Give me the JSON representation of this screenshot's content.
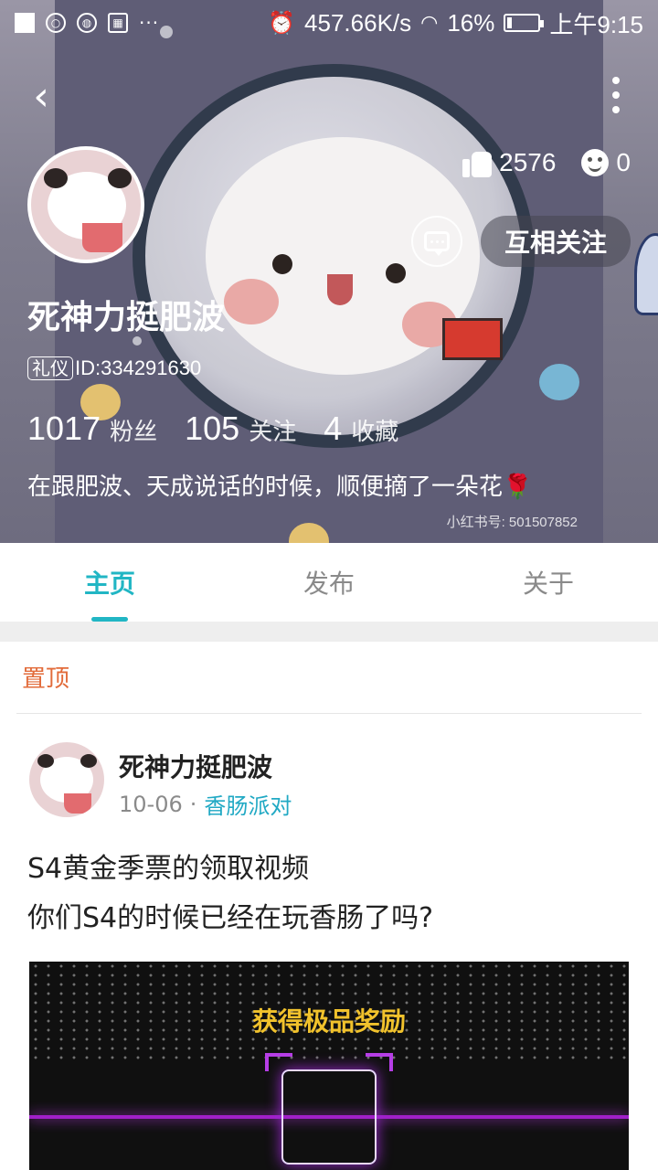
{
  "status_bar": {
    "speed": "457.66K/s",
    "battery": "16%",
    "battery_level": 0.16,
    "time": "上午9:15",
    "icons": [
      "square-icon",
      "search-icon",
      "globe-icon",
      "calendar-icon",
      "more-dots-icon",
      "alarm-icon",
      "wifi-icon",
      "battery-icon"
    ]
  },
  "profile": {
    "likes": "2576",
    "comments": "0",
    "follow_label": "互相关注",
    "nickname": "死神力挺肥波",
    "tag": "礼仪",
    "id_text": "ID:334291630",
    "fans_num": "1017",
    "fans_label": "粉丝",
    "following_num": "105",
    "following_label": "关注",
    "fav_num": "4",
    "fav_label": "收藏",
    "bio": "在跟肥波、天成说话的时候，顺便摘了一朵花🌹",
    "watermark": "小红书号: 501507852"
  },
  "tabs": [
    {
      "label": "主页",
      "active": true
    },
    {
      "label": "发布",
      "active": false
    },
    {
      "label": "关于",
      "active": false
    }
  ],
  "feed": {
    "pinned_label": "置顶",
    "post": {
      "author": "死神力挺肥波",
      "date": "10-06",
      "separator": "·",
      "topic": "香肠派对",
      "line1": "S4黄金季票的领取视频",
      "line2": "你们S4的时候已经在玩香肠了吗?",
      "image_title": "获得极品奖励"
    }
  },
  "colors": {
    "accent": "#21b6c4",
    "pinned": "#e26b3a",
    "topic": "#21a9c4"
  }
}
